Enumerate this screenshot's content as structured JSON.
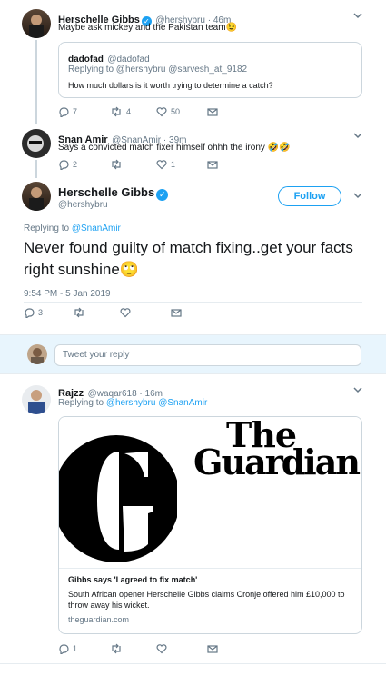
{
  "tweet1": {
    "name": "Herschelle Gibbs",
    "handle_time": "@hershybru · 46m",
    "text": "Maybe ask mickey and the Pakistan team😉",
    "quote": {
      "name": "dadofad",
      "handle": "@dadofad",
      "replying": "Replying to @hershybru @sarvesh_at_9182",
      "text": "How much dollars is it worth trying to determine a catch?"
    },
    "actions": {
      "replies": "7",
      "retweets": "4",
      "likes": "50"
    }
  },
  "tweet2": {
    "name": "Snan Amir",
    "handle_time": "@SnanAmir · 39m",
    "text": "Says a convicted match fixer himself ohhh the irony 🤣🤣",
    "actions": {
      "replies": "2",
      "retweets": "",
      "likes": "1"
    }
  },
  "main_tweet": {
    "name": "Herschelle Gibbs",
    "handle": "@hershybru",
    "follow_label": "Follow",
    "replying_prefix": "Replying to ",
    "replying_to": "@SnanAmir",
    "text": "Never found guilty of match fixing..get your facts right sunshine🙄",
    "timestamp": "9:54 PM - 5 Jan 2019",
    "actions": {
      "replies": "3"
    }
  },
  "reply_box": {
    "placeholder": "Tweet your reply"
  },
  "tweet3": {
    "name": "Rajzz",
    "handle_time": "@waqar618 · 16m",
    "replying_prefix": "Replying to ",
    "replying_to": "@hershybru @SnanAmir",
    "card": {
      "logo_line1": "The",
      "logo_line2": "Guardian",
      "title": "Gibbs says 'I agreed to fix match'",
      "description": "South African opener Herschelle Gibbs claims Cronje offered him £10,000 to throw away his wicket.",
      "domain": "theguardian.com"
    },
    "actions": {
      "replies": "1"
    }
  },
  "colors": {
    "accent": "#1da1f2",
    "muted": "#657786",
    "border": "#ccd6dd"
  },
  "icons": [
    "verified-badge-icon",
    "chevron-down-icon",
    "reply-icon",
    "retweet-icon",
    "like-icon",
    "message-icon"
  ]
}
